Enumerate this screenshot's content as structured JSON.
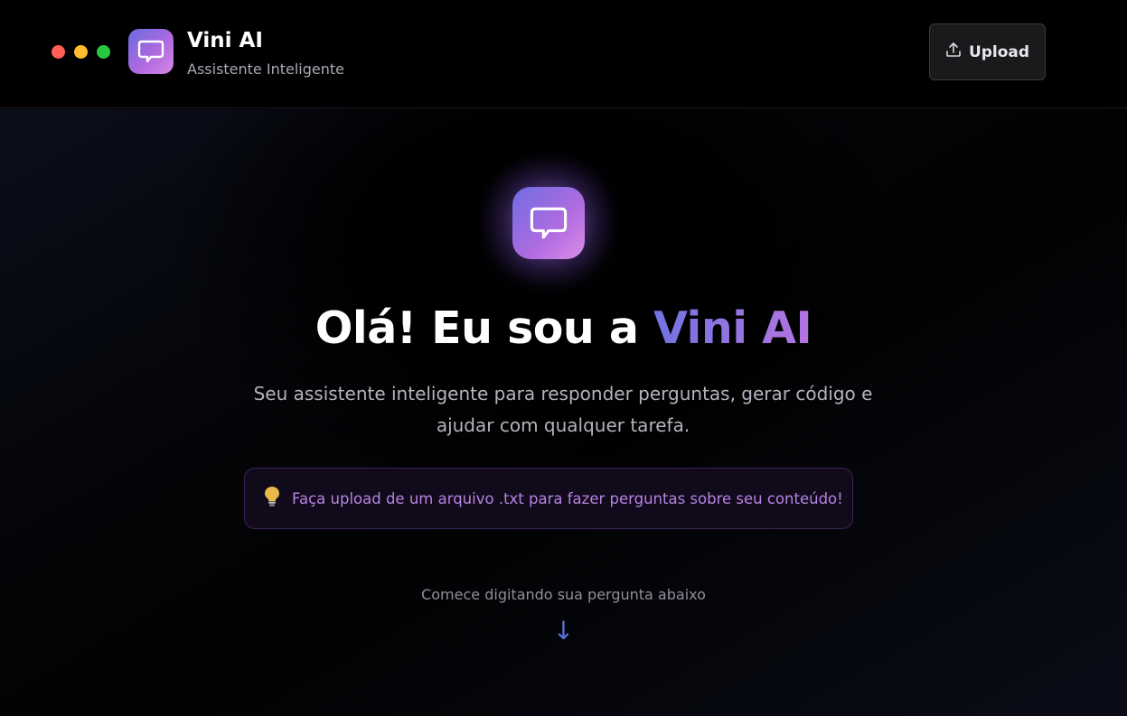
{
  "header": {
    "title": "Vini AI",
    "subtitle": "Assistente Inteligente",
    "upload_label": "Upload",
    "window_controls": [
      "close",
      "minimize",
      "maximize"
    ]
  },
  "main": {
    "headline_prefix": "Olá! Eu sou a ",
    "headline_brand": "Vini AI",
    "description": "Seu assistente inteligente para responder perguntas, gerar código e ajudar com qualquer tarefa.",
    "tip_text": "Faça upload de um arquivo .txt para fazer perguntas sobre seu conteúdo!",
    "hint": "Comece digitando sua pergunta abaixo",
    "arrow": "↓"
  },
  "icons": {
    "logo": "chat-bubble-icon",
    "upload": "upload-icon",
    "tip": "lightbulb-icon"
  },
  "colors": {
    "accent_start": "#7173e2",
    "accent_end": "#b574df",
    "tip_text": "#b783e3",
    "arrow": "#5b6fd6"
  }
}
